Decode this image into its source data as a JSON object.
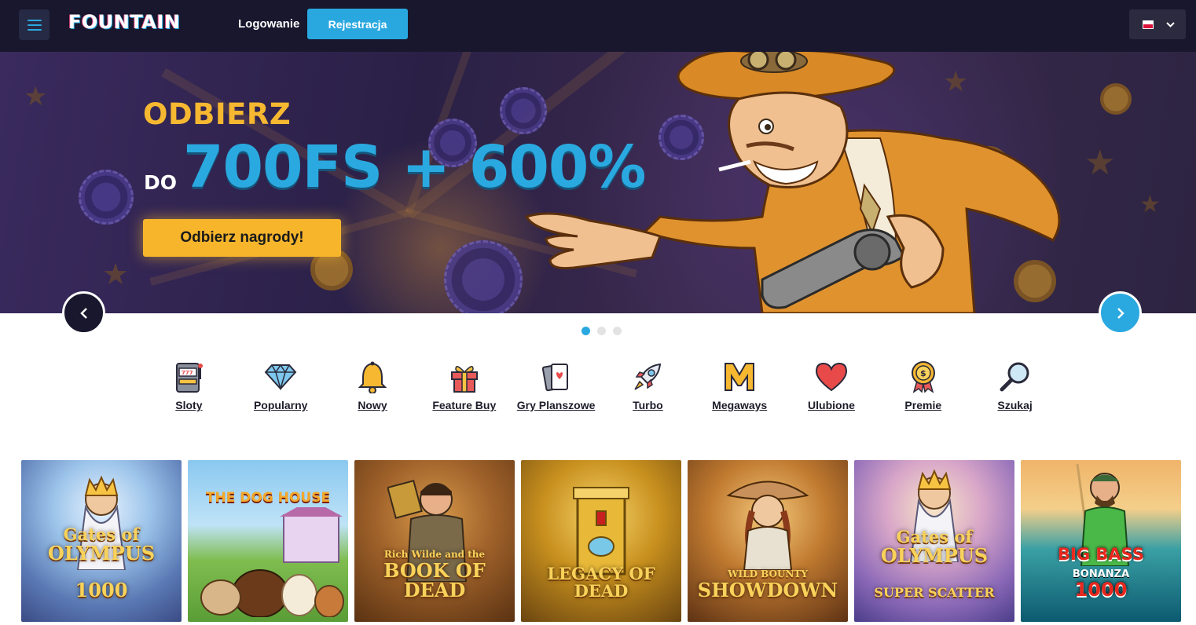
{
  "header": {
    "logo_text": "FOUNTAIN",
    "login_label": "Logowanie",
    "register_label": "Rejestracja"
  },
  "hero": {
    "line1": "ODBIERZ",
    "prefix": "DO",
    "line2": "700FS + 600%",
    "cta_label": "Odbierz nagrody!",
    "slides_total": 3,
    "active_slide": 1
  },
  "categories": [
    {
      "label": "Sloty",
      "icon": "slot-machine-icon"
    },
    {
      "label": "Popularny",
      "icon": "diamond-icon"
    },
    {
      "label": "Nowy",
      "icon": "bell-icon"
    },
    {
      "label": "Feature Buy",
      "icon": "gift-icon"
    },
    {
      "label": "Gry Planszowe",
      "icon": "cards-icon"
    },
    {
      "label": "Turbo",
      "icon": "rocket-icon"
    },
    {
      "label": "Megaways",
      "icon": "megaways-icon"
    },
    {
      "label": "Ulubione",
      "icon": "heart-icon"
    },
    {
      "label": "Premie",
      "icon": "medal-icon"
    },
    {
      "label": "Szukaj",
      "icon": "search-icon"
    }
  ],
  "games": [
    {
      "line1": "Gates of",
      "line2": "OLYMPUS",
      "line3": "1000"
    },
    {
      "line1": "THE DOG HOUSE",
      "line2": "",
      "line3": ""
    },
    {
      "line1": "Rich Wilde and the",
      "line2": "BOOK OF DEAD",
      "line3": ""
    },
    {
      "line1": "LEGACY OF DEAD",
      "line2": "",
      "line3": ""
    },
    {
      "line1": "WILD BOUNTY",
      "line2": "SHOWDOWN",
      "line3": ""
    },
    {
      "line1": "Gates of",
      "line2": "OLYMPUS",
      "line3": "SUPER SCATTER"
    },
    {
      "line1": "BIG BASS",
      "line2": "BONANZA",
      "line3": "1000"
    }
  ],
  "colors": {
    "header_bg": "#18172d",
    "accent_blue": "#2aa9e0",
    "accent_yellow": "#f7b52c"
  }
}
